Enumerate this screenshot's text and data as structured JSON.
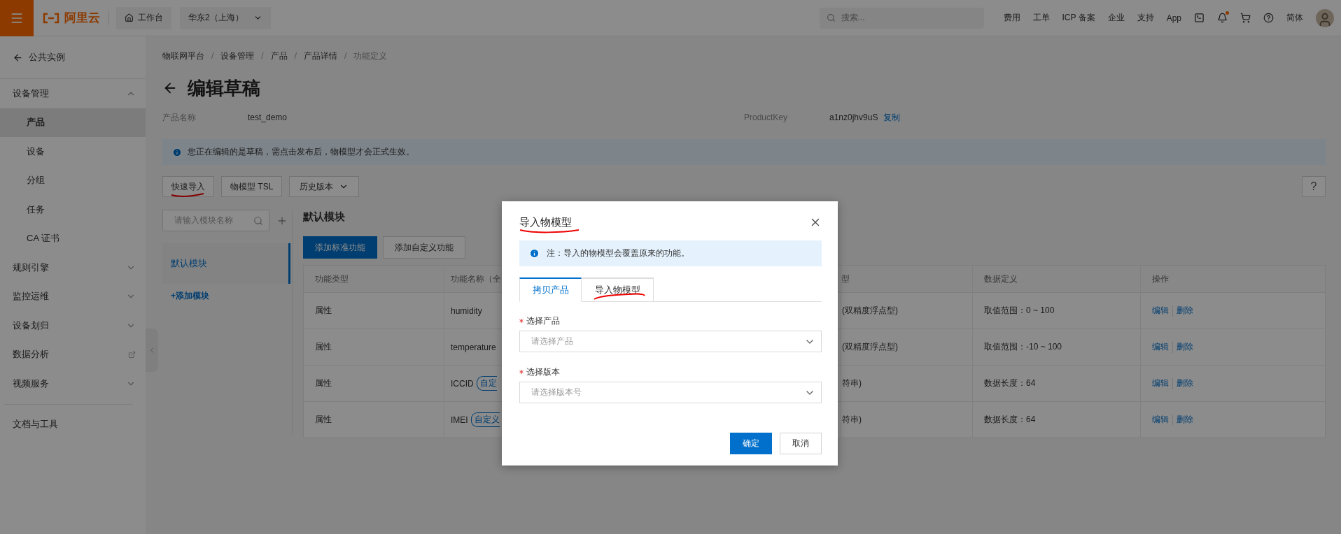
{
  "top_bar": {
    "logo": "阿里云",
    "workbench": "工作台",
    "region": "华东2（上海）",
    "search": {
      "placeholder": "搜索..."
    },
    "links": [
      "费用",
      "工单",
      "ICP 备案",
      "企业",
      "支持",
      "App"
    ],
    "bell": {
      "unread": true
    },
    "language": "简体"
  },
  "sidebar": {
    "back": "公共实例",
    "items": [
      {
        "label": "设备管理",
        "kind": "group",
        "expanded": true,
        "children": [
          {
            "label": "产品",
            "selected": true
          },
          {
            "label": "设备",
            "selected": false
          },
          {
            "label": "分组",
            "selected": false
          },
          {
            "label": "任务",
            "selected": false
          },
          {
            "label": "CA 证书",
            "selected": false
          }
        ]
      },
      {
        "label": "规则引擎",
        "kind": "group",
        "expanded": false
      },
      {
        "label": "监控运维",
        "kind": "group",
        "expanded": false
      },
      {
        "label": "设备划归",
        "kind": "group",
        "expanded": false
      },
      {
        "label": "数据分析",
        "kind": "external"
      },
      {
        "label": "视频服务",
        "kind": "group",
        "expanded": false
      }
    ],
    "footer": "文档与工具"
  },
  "breadcrumb": {
    "separator": "/",
    "items": [
      "物联网平台",
      "设备管理",
      "产品",
      "产品详情",
      "功能定义"
    ]
  },
  "page_title": "编辑草稿",
  "product": {
    "name_label": "产品名称",
    "name": "test_demo",
    "key_label": "ProductKey",
    "key": "a1nz0jhv9uS",
    "copy": "复制"
  },
  "notice": "您正在编辑的是草稿，需点击发布后，物模型才会正式生效。",
  "toolbar": {
    "buttons": [
      {
        "label": "快速导入",
        "kind": "button"
      },
      {
        "label": "物模型 TSL",
        "kind": "button"
      },
      {
        "label": "历史版本",
        "kind": "dropdown"
      }
    ],
    "help": "?"
  },
  "modules": {
    "search": {
      "placeholder": "请输入模块名称"
    },
    "items": [
      {
        "label": "默认模块",
        "selected": true
      }
    ],
    "add": "+添加模块"
  },
  "module_panel": {
    "title": "默认模块",
    "buttons": [
      {
        "label": "添加标准功能",
        "kind": "primary"
      },
      {
        "label": "添加自定义功能",
        "kind": "default"
      }
    ]
  },
  "table": {
    "columns": [
      "功能类型",
      "功能名称（全",
      "型",
      "数据定义",
      "操作"
    ],
    "rows": [
      {
        "type": "属性",
        "name": "humidity",
        "data_type": "(双精度浮点型)",
        "definition": "取值范围：0 ~ 100",
        "actions": [
          "编辑",
          "删除"
        ]
      },
      {
        "type": "属性",
        "name": "temperature",
        "data_type": "(双精度浮点型)",
        "definition": "取值范围：-10 ~ 100",
        "actions": [
          "编辑",
          "删除"
        ]
      },
      {
        "type": "属性",
        "name": "ICCID",
        "tag": "自定",
        "data_type": "符串)",
        "definition": "数据长度：64",
        "actions": [
          "编辑",
          "删除"
        ]
      },
      {
        "type": "属性",
        "name": "IMEI",
        "tag": "自定义",
        "data_type": "符串)",
        "definition": "数据长度：64",
        "actions": [
          "编辑",
          "删除"
        ]
      }
    ]
  },
  "dialog": {
    "title": "导入物模型",
    "notice": "注：导入的物模型会覆盖原来的功能。",
    "tabs": [
      {
        "label": "拷贝产品",
        "selected": true
      },
      {
        "label": "导入物模型",
        "selected": false
      }
    ],
    "fields": [
      {
        "label": "选择产品",
        "required": true,
        "placeholder": "请选择产品"
      },
      {
        "label": "选择版本",
        "required": true,
        "placeholder": "请选择版本号"
      }
    ],
    "buttons": [
      {
        "label": "确定",
        "kind": "primary"
      },
      {
        "label": "取消",
        "kind": "default"
      }
    ]
  }
}
